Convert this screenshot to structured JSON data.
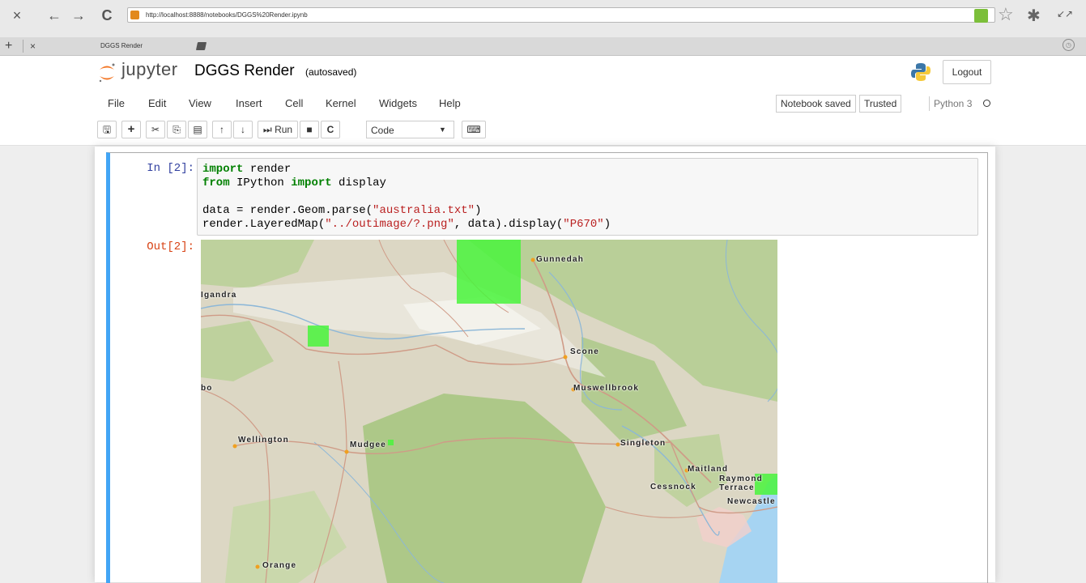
{
  "browser": {
    "url": "http://localhost:8888/notebooks/DGGS%20Render.ipynb",
    "tab_title": "DGGS Render",
    "close_glyph": "×",
    "back_glyph": "←",
    "forward_glyph": "→",
    "reload_glyph": "C",
    "new_tab_glyph": "+",
    "tab_close_glyph": "×"
  },
  "jupyter": {
    "logo_text": "jupyter",
    "notebook_name": "DGGS Render",
    "autosave_status": "(autosaved)",
    "logout_label": "Logout",
    "menu": [
      "File",
      "Edit",
      "View",
      "Insert",
      "Cell",
      "Kernel",
      "Widgets",
      "Help"
    ],
    "notebook_saved": "Notebook saved",
    "trusted": "Trusted",
    "kernel_name": "Python 3",
    "toolbar": {
      "run_label": "Run",
      "cell_type": "Code"
    }
  },
  "cell": {
    "in_prompt": "In [2]:",
    "out_prompt": "Out[2]:",
    "code": {
      "line1_kw": "import",
      "line1_rest": " render",
      "line2_kw1": "from",
      "line2_mid": " IPython ",
      "line2_kw2": "import",
      "line2_rest": " display",
      "line4_pre": "data = render.Geom.parse(",
      "line4_str": "\"australia.txt\"",
      "line4_post": ")",
      "line5_pre": "render.LayeredMap(",
      "line5_str": "\"../outimage/?.png\"",
      "line5_mid": ", data).display(",
      "line5_str2": "\"P670\"",
      "line5_post": ")"
    }
  },
  "map": {
    "labels": {
      "gunnedah": "Gunnedah",
      "gilgandra": "Igandra",
      "scone": "Scone",
      "muswellbrook": "Muswellbrook",
      "dubbo": "bo",
      "wellington": "Wellington",
      "mudgee": "Mudgee",
      "singleton": "Singleton",
      "maitland": "Maitland",
      "cessnock": "Cessnock",
      "raymond_terrace": "Raymond Terrace",
      "newcastle": "Newcastle",
      "orange": "Orange"
    },
    "highlight_color": "#49f53c"
  },
  "colors": {
    "cell_selected_border": "#42a5f5",
    "in_prompt": "#303f9f",
    "out_prompt": "#d84315"
  }
}
